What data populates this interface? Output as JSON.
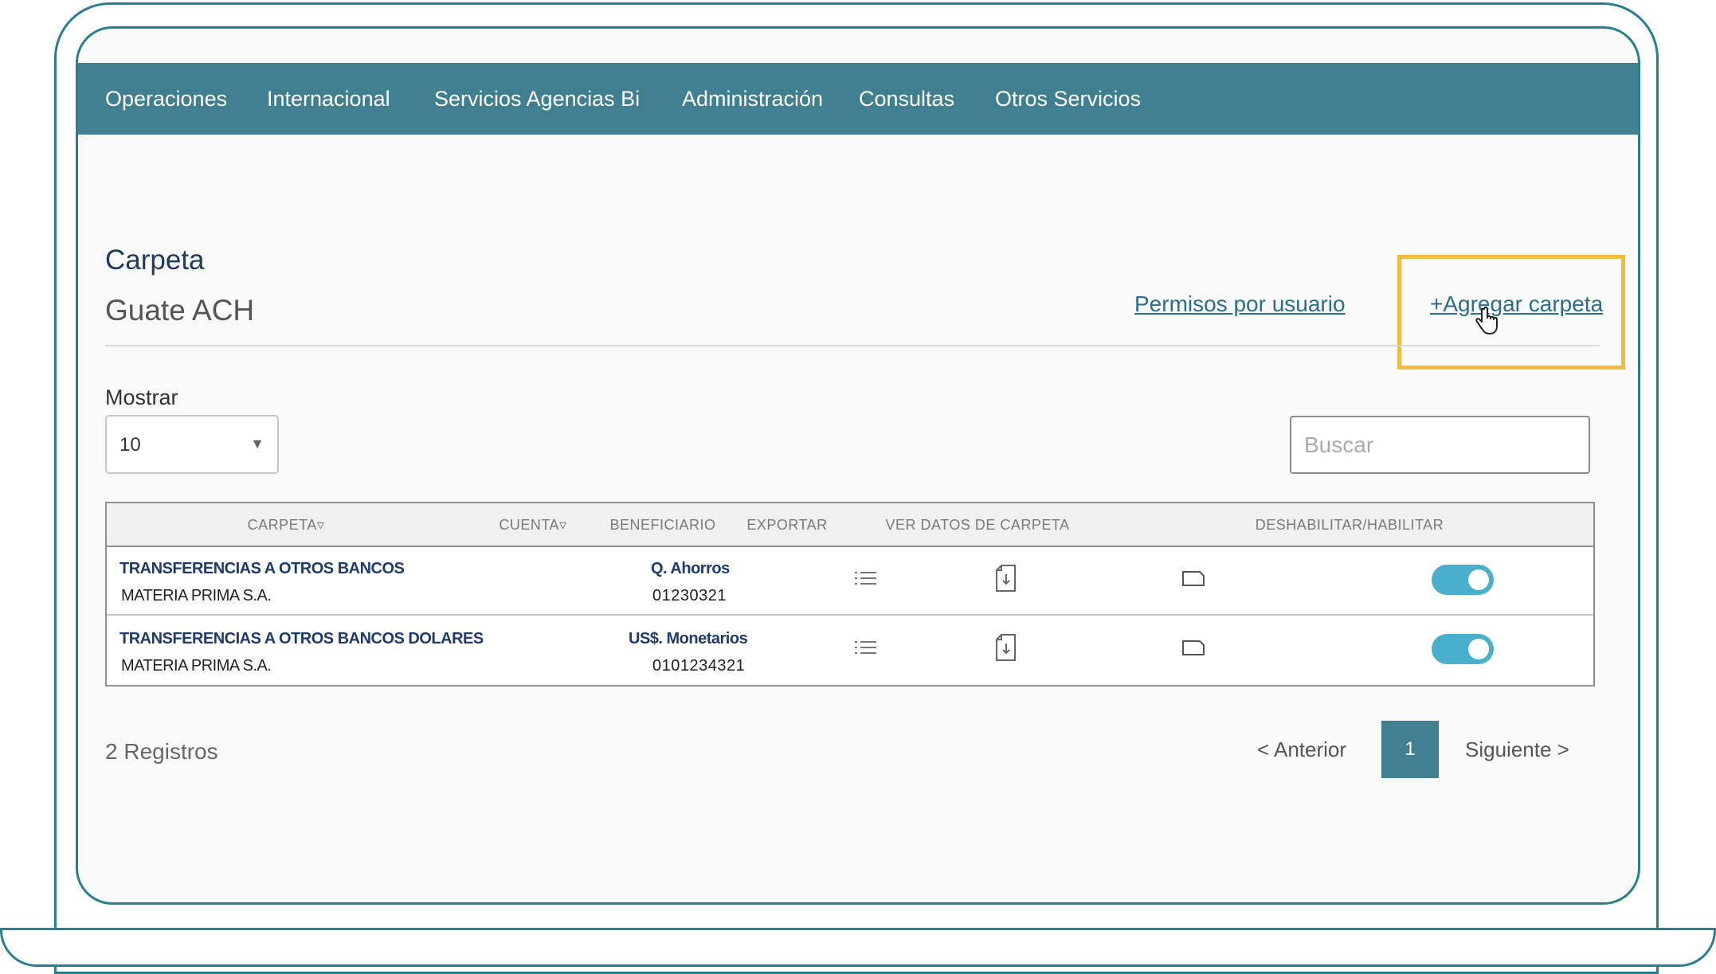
{
  "nav": {
    "items": [
      "Operaciones",
      "Internacional",
      "Servicios Agencias Bi",
      "Administración",
      "Consultas",
      "Otros Servicios"
    ]
  },
  "header": {
    "title": "Carpeta",
    "subtitle": "Guate ACH",
    "permisos_link": "Permisos por usuario",
    "agregar_link": "+Agregar carpeta"
  },
  "controls": {
    "mostrar_label": "Mostrar",
    "page_size": "10",
    "search_placeholder": "Buscar"
  },
  "table": {
    "columns": [
      "CARPETA▿",
      "CUENTA▿",
      "BENEFICIARIO",
      "EXPORTAR",
      "VER DATOS DE CARPETA",
      "DESHABILITAR/HABILITAR"
    ],
    "rows": [
      {
        "carpeta": "TRANSFERENCIAS A OTROS BANCOS",
        "empresa": "MATERIA PRIMA S.A.",
        "cuenta_tipo": "Q. Ahorros",
        "cuenta_num": "01230321",
        "habilitado": true
      },
      {
        "carpeta": "TRANSFERENCIAS A OTROS BANCOS DOLARES",
        "empresa": "MATERIA PRIMA S.A.",
        "cuenta_tipo": "US$. Monetarios",
        "cuenta_num": "0101234321",
        "habilitado": true
      }
    ]
  },
  "footer": {
    "registros": "2 Registros",
    "prev": "< Anterior",
    "current_page": "1",
    "next": "Siguiente >"
  },
  "icons": {
    "beneficiario": "list-icon",
    "exportar": "file-export-icon",
    "ver_datos": "folder-icon",
    "cursor": "hand-pointer-icon"
  },
  "colors": {
    "frame": "#2a7f8c",
    "navbar": "#3f7f90",
    "toggle": "#49afcc",
    "highlight": "#f2bb3d",
    "link": "#2a6e8c"
  }
}
